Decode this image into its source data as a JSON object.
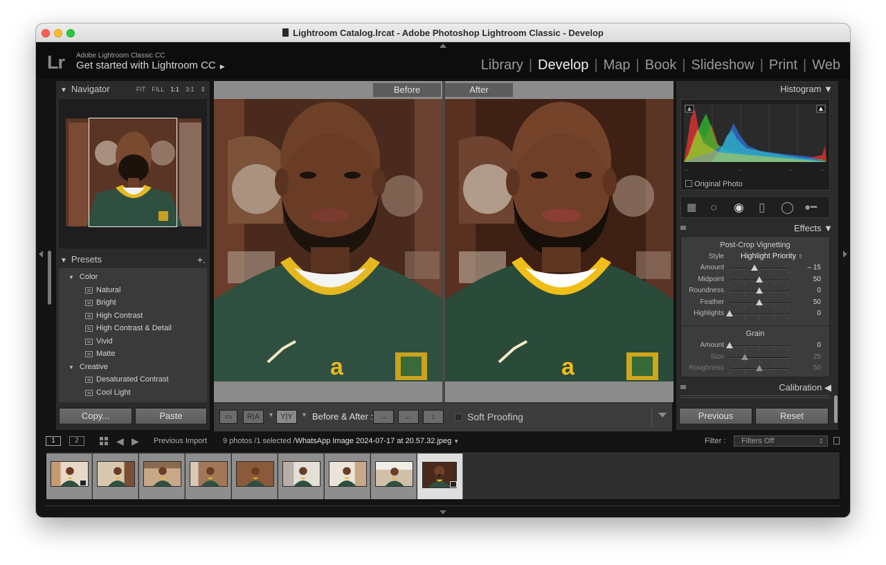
{
  "window": {
    "title": "Lightroom Catalog.lrcat - Adobe Photoshop Lightroom Classic - Develop"
  },
  "identity": {
    "logo": "Lr",
    "product": "Adobe Lightroom Classic CC",
    "promo": "Get started with Lightroom CC",
    "promo_arrow": "▶"
  },
  "modules": {
    "library": "Library",
    "develop": "Develop",
    "map": "Map",
    "book": "Book",
    "slideshow": "Slideshow",
    "print": "Print",
    "web": "Web",
    "separator": "|"
  },
  "navigator": {
    "title": "Navigator",
    "zoom": [
      "FIT",
      "FILL",
      "1:1",
      "3:1"
    ],
    "selected_zoom": "1:1"
  },
  "presets": {
    "title": "Presets",
    "add": "+.",
    "groups": [
      {
        "name": "Color",
        "items": [
          "Natural",
          "Bright",
          "High Contrast",
          "High Contrast & Detail",
          "Vivid",
          "Matte"
        ]
      },
      {
        "name": "Creative",
        "items": [
          "Desaturated Contrast",
          "Cool Light"
        ]
      }
    ]
  },
  "left_buttons": {
    "copy": "Copy...",
    "paste": "Paste"
  },
  "compare": {
    "before_label": "Before",
    "after_label": "After"
  },
  "toolbar": {
    "before_after_label": "Before & After :",
    "soft_proofing": "Soft Proofing",
    "ra_label": "R|A",
    "yy_label": "Y|Y"
  },
  "histogram": {
    "title": "Histogram",
    "original_photo": "Original Photo"
  },
  "effects": {
    "title": "Effects",
    "vignette_title": "Post-Crop Vignetting",
    "style_label": "Style",
    "style_value": "Highlight Priority",
    "sliders": [
      {
        "label": "Amount",
        "value": "– 15",
        "pos": 0.42
      },
      {
        "label": "Midpoint",
        "value": "50",
        "pos": 0.5
      },
      {
        "label": "Roundness",
        "value": "0",
        "pos": 0.5
      },
      {
        "label": "Feather",
        "value": "50",
        "pos": 0.5
      },
      {
        "label": "Highlights",
        "value": "0",
        "pos": 0.0
      }
    ],
    "grain_title": "Grain",
    "grain_sliders": [
      {
        "label": "Amount",
        "value": "0",
        "pos": 0.0
      },
      {
        "label": "Size",
        "value": "25",
        "pos": 0.25
      },
      {
        "label": "Roughness",
        "value": "50",
        "pos": 0.5
      }
    ]
  },
  "calibration": {
    "title": "Calibration"
  },
  "right_buttons": {
    "previous": "Previous",
    "reset": "Reset"
  },
  "filmstrip_bar": {
    "view1": "1",
    "view2": "2",
    "source": "Previous Import",
    "count": "9 photos /1 selected /",
    "filename": "WhatsApp Image 2024-07-17 at 20.57.32.jpeg",
    "filter_label": "Filter :",
    "filter_value": "Filters Off"
  },
  "filmstrip": {
    "thumb_count": 9,
    "selected_index": 8
  },
  "colors": {
    "accent_selected": "#dedede",
    "panel_bg": "#2b2b2b",
    "jersey_green": "#2f5040",
    "jersey_gold": "#e6b820"
  }
}
